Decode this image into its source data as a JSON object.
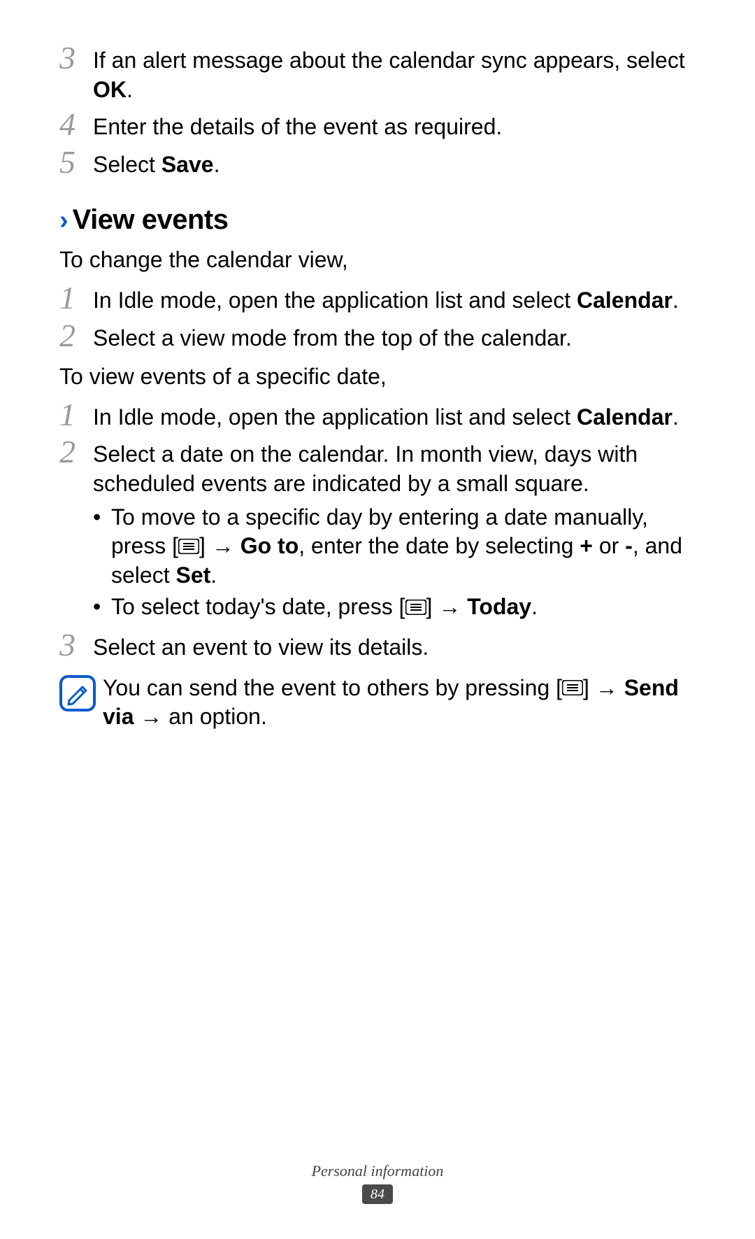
{
  "step3": {
    "num": "3",
    "pre": "If an alert message about the calendar sync appears, select ",
    "bold": "OK",
    "post": "."
  },
  "step4": {
    "num": "4",
    "text": "Enter the details of the event as required."
  },
  "step5": {
    "num": "5",
    "pre": "Select ",
    "bold": "Save",
    "post": "."
  },
  "heading": "View events",
  "intro1": "To change the calendar view,",
  "a_step1": {
    "num": "1",
    "pre": "In Idle mode, open the application list and select ",
    "bold": "Calendar",
    "post": "."
  },
  "a_step2": {
    "num": "2",
    "text": "Select a view mode from the top of the calendar."
  },
  "intro2": "To view events of a specific date,",
  "b_step1": {
    "num": "1",
    "pre": "In Idle mode, open the application list and select ",
    "bold": "Calendar",
    "post": "."
  },
  "b_step2": {
    "num": "2",
    "text": "Select a date on the calendar. In month view, days with scheduled events are indicated by a small square."
  },
  "bullet1": {
    "p1": "To move to a specific day by entering a date manually, press [",
    "p2": "] → ",
    "b1": "Go to",
    "p3": ", enter the date by selecting ",
    "b2": "+",
    "p4": " or ",
    "b3": "-",
    "p5": ", and select ",
    "b4": "Set",
    "p6": "."
  },
  "bullet2": {
    "p1": "To select today's date, press [",
    "p2": "] → ",
    "b1": "Today",
    "p3": "."
  },
  "b_step3": {
    "num": "3",
    "text": "Select an event to view its details."
  },
  "note": {
    "p1": "You can send the event to others by pressing [",
    "p2": "] → ",
    "b1": "Send via",
    "p3": " → an option."
  },
  "footer": {
    "section": "Personal information",
    "page": "84"
  }
}
